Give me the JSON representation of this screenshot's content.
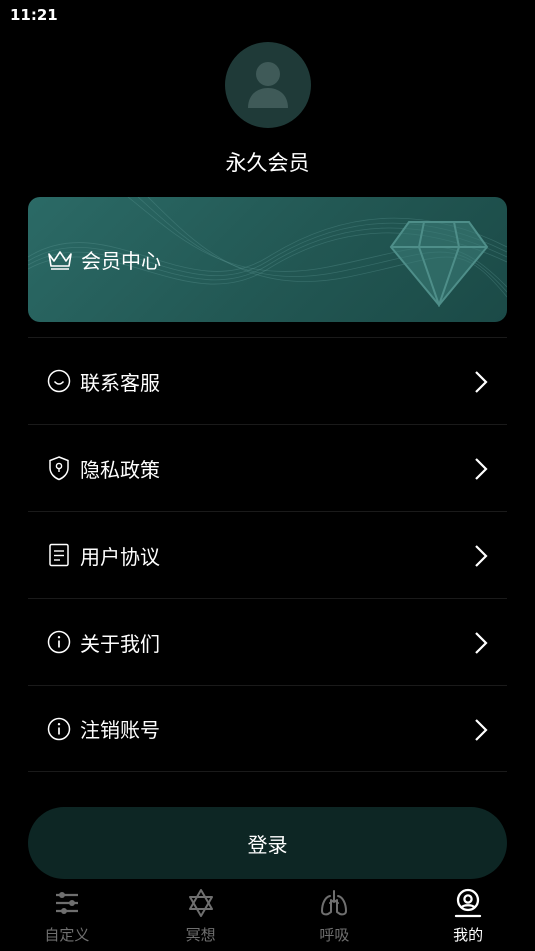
{
  "status_bar": {
    "time": "11:21"
  },
  "profile": {
    "avatar_icon": "user-silhouette-icon",
    "member_level": "永久会员"
  },
  "vip_card": {
    "label": "会员中心",
    "icon": "crown-icon",
    "decoration": "diamond-icon",
    "color": "#2b6a66"
  },
  "menu": {
    "items": [
      {
        "label": "联系客服",
        "icon": "smile-icon"
      },
      {
        "label": "隐私政策",
        "icon": "shield-icon"
      },
      {
        "label": "用户协议",
        "icon": "document-icon"
      },
      {
        "label": "关于我们",
        "icon": "info-icon"
      },
      {
        "label": "注销账号",
        "icon": "info-icon"
      }
    ]
  },
  "login_button": {
    "label": "登录"
  },
  "tab_bar": {
    "active": "我的",
    "tabs": [
      {
        "label": "自定义",
        "icon": "sliders-icon"
      },
      {
        "label": "冥想",
        "icon": "star-of-david-icon"
      },
      {
        "label": "呼吸",
        "icon": "lungs-icon"
      },
      {
        "label": "我的",
        "icon": "profile-icon"
      }
    ]
  }
}
